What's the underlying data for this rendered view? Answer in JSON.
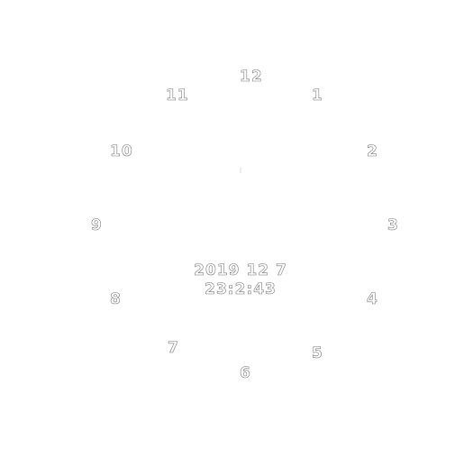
{
  "clock": {
    "numerals": {
      "n12": "12",
      "n1": "1",
      "n2": "2",
      "n3": "3",
      "n4": "4",
      "n5": "5",
      "n6": "6",
      "n7": "7",
      "n8": "8",
      "n9": "9",
      "n10": "10",
      "n11": "11"
    },
    "date": "2019 12 7",
    "time": "23:2:43"
  }
}
